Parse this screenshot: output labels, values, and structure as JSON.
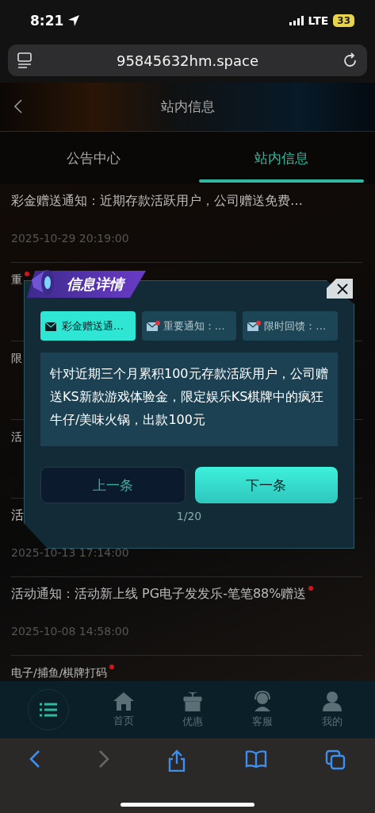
{
  "status_bar": {
    "time": "8:21",
    "network": "LTE",
    "battery": "33"
  },
  "address_bar": {
    "url": "95845632hm.space"
  },
  "header": {
    "title": "站内信息"
  },
  "tabs": [
    {
      "label": "公告中心",
      "selected": false
    },
    {
      "label": "站内信息",
      "selected": true
    }
  ],
  "messages": [
    {
      "title": "彩金赠送通知：近期存款活跃用户，公司赠送免费…",
      "date": "2025-10-29 20:19:00",
      "unread": false
    },
    {
      "title": "重",
      "unread": true
    },
    {
      "title": "限"
    },
    {
      "title": "活"
    },
    {
      "title": "活",
      "date": "2025-10-13 17:14:00"
    },
    {
      "title": "活动通知：活动新上线 PG电子发发乐-笔笔88%赠送",
      "date": "2025-10-08 14:58:00",
      "unread": true
    },
    {
      "title": "电子/捕鱼/棋牌打码",
      "unread": true
    }
  ],
  "dialog": {
    "title": "信息详情",
    "tabs": [
      {
        "label": "彩金赠送通…",
        "selected": true,
        "unread": false
      },
      {
        "label": "重要通知：…",
        "selected": false,
        "unread": true
      },
      {
        "label": "限时回馈：…",
        "selected": false,
        "unread": true
      }
    ],
    "body": "针对近期三个月累积100元存款活跃用户，公司赠送KS新款游戏体验金，限定娱乐KS棋牌中的疯狂牛仔/美味火锅，出款100元",
    "buttons": [
      {
        "label": "上一条",
        "kind": "secondary"
      },
      {
        "label": "下一条",
        "kind": "primary"
      }
    ],
    "page": "1/20"
  },
  "bottom_nav": [
    {
      "label": "首页",
      "kind": "home"
    },
    {
      "label": "优惠",
      "kind": "gift"
    },
    {
      "label": "客服",
      "kind": "support"
    },
    {
      "label": "我的",
      "kind": "user"
    }
  ]
}
